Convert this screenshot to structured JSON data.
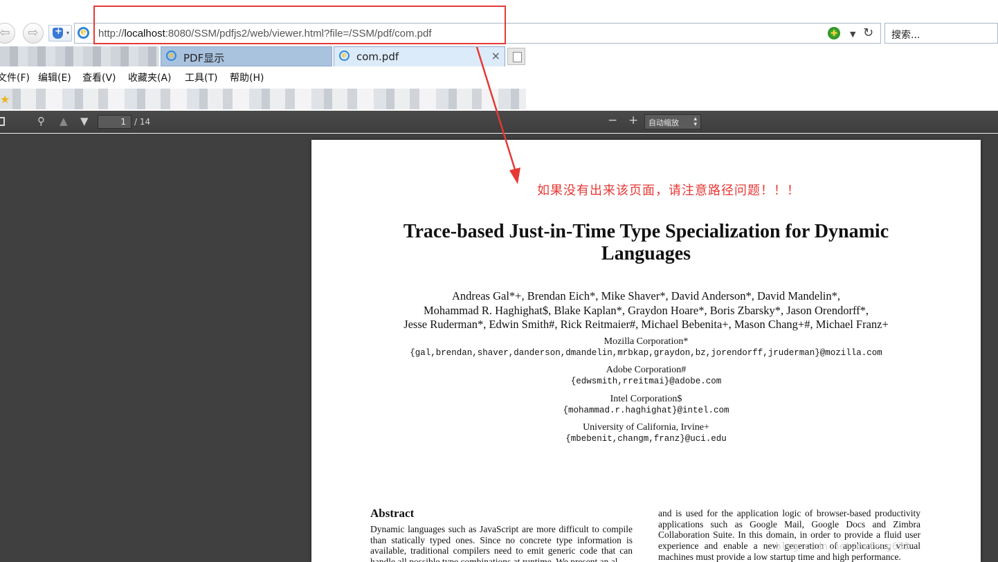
{
  "browser": {
    "address_url_prefix": "http://",
    "address_url_host": "localhost",
    "address_url_rest": ":8080/SSM/pdfjs2/web/viewer.html?file=/SSM/pdf/com.pdf",
    "search_placeholder": "搜索...",
    "tabs": [
      {
        "label": "PDF显示"
      },
      {
        "label": "com.pdf",
        "close": "×"
      }
    ],
    "menu": [
      "文件(F)",
      "编辑(E)",
      "查看(V)",
      "收藏夹(A)",
      "工具(T)",
      "帮助(H)"
    ]
  },
  "pdf_toolbar": {
    "page_number": "1",
    "page_count": "/ 14",
    "zoom_label": "自动缩放"
  },
  "annotation": {
    "note": "如果没有出来该页面，请注意路径问题！！！",
    "color": "#e53935"
  },
  "paper": {
    "title_line1": "Trace-based Just-in-Time Type Specialization for Dynamic",
    "title_line2": "Languages",
    "authors_line1": "Andreas Gal*+, Brendan Eich*, Mike Shaver*, David Anderson*, David Mandelin*,",
    "authors_line2": "Mohammad R. Haghighat$, Blake Kaplan*, Graydon Hoare*, Boris Zbarsky*, Jason Orendorff*,",
    "authors_line3": "Jesse Ruderman*, Edwin Smith#, Rick Reitmaier#, Michael Bebenita+, Mason Chang+#, Michael Franz+",
    "affiliations": [
      {
        "name": "Mozilla Corporation*",
        "email": "{gal,brendan,shaver,danderson,dmandelin,mrbkap,graydon,bz,jorendorff,jruderman}@mozilla.com"
      },
      {
        "name": "Adobe Corporation#",
        "email": "{edwsmith,rreitmai}@adobe.com"
      },
      {
        "name": "Intel Corporation$",
        "email": "{mohammad.r.haghighat}@intel.com"
      },
      {
        "name": "University of California, Irvine+",
        "email": "{mbebenit,changm,franz}@uci.edu"
      }
    ],
    "abstract_heading": "Abstract",
    "abstract_left": "Dynamic languages such as JavaScript are more difficult to compile than statically typed ones. Since no concrete type information is available, traditional compilers need to emit generic code that can handle all possible type combinations at runtime. We present an al-",
    "abstract_right": "and is used for the application logic of browser-based productivity applications such as Google Mail, Google Docs and Zimbra Collaboration Suite. In this domain, in order to provide a fluid user experience and enable a new generation of applications, virtual machines must provide a low startup time and high performance."
  },
  "watermark": "blog.csdn.net/mufeng633"
}
